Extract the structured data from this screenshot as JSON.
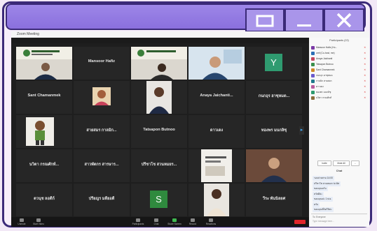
{
  "window": {
    "app_title": "Zoom Meeting"
  },
  "tiles": [
    {
      "name": "",
      "label": ""
    },
    {
      "name": "Mansoor Hafiz",
      "label": ""
    },
    {
      "name": "",
      "label": ""
    },
    {
      "name": "",
      "label": ""
    },
    {
      "name": "",
      "label": "",
      "letter": "Y",
      "letter_color": "#2f9b70"
    },
    {
      "name": "Sant Chamanmek",
      "label": ""
    },
    {
      "name": "",
      "label": ""
    },
    {
      "name": "",
      "label": ""
    },
    {
      "name": "Anaya Jaichanti...",
      "label": ""
    },
    {
      "name": "กนกอุร ฮาซุหมด...",
      "label": ""
    },
    {
      "name": "",
      "label": ""
    },
    {
      "name": "สายสมร กาลมิก...",
      "label": ""
    },
    {
      "name": "Tatsapon Butnoo",
      "label": ""
    },
    {
      "name": "ดาวเดง",
      "label": ""
    },
    {
      "name": "ทองพร มนกลิซุ",
      "label": ""
    },
    {
      "name": "นวิตา กรณศักท์...",
      "label": ""
    },
    {
      "name": "สาวพัตกร สารษาร...",
      "label": ""
    },
    {
      "name": "ปรีชาโช สวนหมยร...",
      "label": ""
    },
    {
      "name": "",
      "label": ""
    },
    {
      "name": "",
      "label": ""
    },
    {
      "name": "ตวนุช ลอดีก์",
      "label": ""
    },
    {
      "name": "ปรียญร มดียอดี",
      "label": ""
    },
    {
      "name": "",
      "label": "",
      "letter": "S",
      "letter_color": "#2f8a3e"
    },
    {
      "name": "",
      "label": ""
    },
    {
      "name": "วีระ พันนิลยศ",
      "label": ""
    }
  ],
  "participants": {
    "title": "Participants (22)",
    "people": [
      {
        "name": "Mansoor Hafiz (Ho...",
        "color": "#7b3aa6"
      },
      {
        "name": "umf (Co-host, me)",
        "color": "#2c6fb5"
      },
      {
        "name": "Anaya Jaichanti",
        "color": "#c4455b"
      },
      {
        "name": "Tatsapon Butnoo",
        "color": "#3b8f4b"
      },
      {
        "name": "Sant Chamanmek",
        "color": "#d08a28"
      },
      {
        "name": "กนกอุร ฮาซุหมด",
        "color": "#6a5acd"
      },
      {
        "name": "กาลมิก สายสมร",
        "color": "#1f7a8c"
      },
      {
        "name": "ดาวเดง",
        "color": "#b85c9e"
      },
      {
        "name": "ทองพร มนกลิซุ",
        "color": "#2f9b70"
      },
      {
        "name": "นวิตา กรณศักท์",
        "color": "#8a6d3b"
      }
    ],
    "invite_label": "Invite",
    "mute_all_label": "Mute All",
    "more_label": "..."
  },
  "chat": {
    "title": "Chat",
    "messages": [
      "รอบบ่ายสาม 14:00",
      "ปรีชาโช สวนหมยร to Me",
      "ขอบคุณครับ",
      "สวัสดีค่ะ",
      "ขอบคุณค่ะ 1 พ.ย.",
      "ครับ",
      "ขอบคุณที่จัดให้ค่ะ"
    ],
    "to_label": "To: Everyone",
    "placeholder": "Type message here..."
  },
  "toolbar": {
    "items": [
      "Unmute",
      "Start Video",
      "Participants",
      "Chat",
      "Share Screen",
      "Record",
      "Reactions"
    ],
    "end_label": "End"
  }
}
